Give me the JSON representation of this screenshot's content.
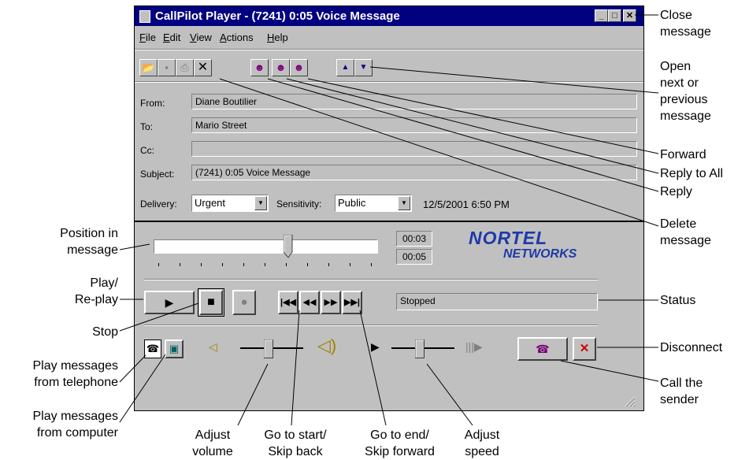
{
  "window": {
    "title": "CallPilot Player - (7241) 0:05 Voice Message",
    "menu": [
      "File",
      "Edit",
      "View",
      "Actions",
      "Help"
    ]
  },
  "header": {
    "from_label": "From:",
    "from_value": "Diane Boutilier",
    "to_label": "To:",
    "to_value": "Mario Street",
    "cc_label": "Cc:",
    "cc_value": "",
    "subject_label": "Subject:",
    "subject_value": "(7241) 0:05 Voice Message",
    "delivery_label": "Delivery:",
    "delivery_value": "Urgent",
    "sensitivity_label": "Sensitivity:",
    "sensitivity_value": "Public",
    "timestamp": "12/5/2001 6:50 PM"
  },
  "player": {
    "position_time": "00:03",
    "total_time": "00:05",
    "position_fraction": 0.6,
    "volume_fraction": 0.45,
    "speed_fraction": 0.45,
    "status": "Stopped",
    "logo_line1": "NORTEL",
    "logo_line2": "NETWORKS"
  },
  "annotations": {
    "close_1": "Close",
    "close_2": "message",
    "open_1": "Open",
    "open_2": "next or",
    "open_3": "previous",
    "open_4": "message",
    "forward": "Forward",
    "reply_all": "Reply to All",
    "reply": "Reply",
    "delete_1": "Delete",
    "delete_2": "message",
    "position_1": "Position in",
    "position_2": "message",
    "play_1": "Play/",
    "play_2": "Re-play",
    "status": "Status",
    "stop": "Stop",
    "disconnect": "Disconnect",
    "tel_1": "Play messages",
    "tel_2": "from telephone",
    "call_1": "Call the",
    "call_2": "sender",
    "comp_1": "Play messages",
    "comp_2": "from computer",
    "vol_1": "Adjust",
    "vol_2": "volume",
    "start_1": "Go to start/",
    "start_2": "Skip back",
    "end_1": "Go to end/",
    "end_2": "Skip forward",
    "speed_1": "Adjust",
    "speed_2": "speed"
  }
}
